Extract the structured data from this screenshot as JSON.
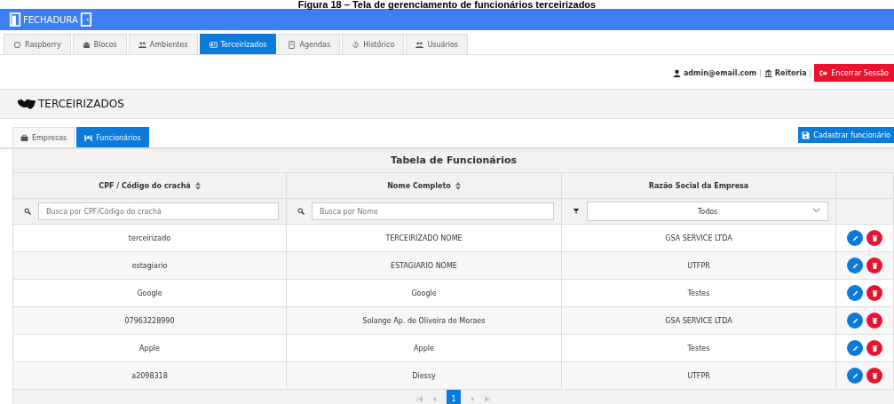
{
  "caption": "Figura 18 – Tela de gerenciamento de funcionários terceirizados",
  "brand": "FECHADURA",
  "nav_tabs": [
    {
      "label": "Raspberry",
      "selected": false
    },
    {
      "label": "Blocos",
      "selected": false
    },
    {
      "label": "Ambientes",
      "selected": false
    },
    {
      "label": "Terceirizados",
      "selected": true
    },
    {
      "label": "Agendas",
      "selected": false
    },
    {
      "label": "Histórico",
      "selected": false
    },
    {
      "label": "Usuários",
      "selected": false
    }
  ],
  "user_bar": {
    "email": "admin@email.com",
    "separator_1": "|",
    "unit": "Reitoria",
    "separator_2": "|",
    "logout": "Encerrar Sessão"
  },
  "page_title": "TERCEIRIZADOS",
  "sub_tabs": [
    {
      "label": "Empresas",
      "selected": false
    },
    {
      "label": "Funcionários",
      "selected": true
    }
  ],
  "create_button": "Cadastrar funcionário",
  "table": {
    "title": "Tabela de Funcionários",
    "columns": [
      {
        "label": "CPF / Código do crachá",
        "sortable": true
      },
      {
        "label": "Nome Completo",
        "sortable": true
      },
      {
        "label": "Razão Social da Empresa",
        "sortable": false
      }
    ],
    "filters": [
      {
        "kind": "search",
        "placeholder": "Busca por CPF/Código do crachá"
      },
      {
        "kind": "search",
        "placeholder": "Busca por Nome"
      },
      {
        "kind": "select",
        "value": "Todos"
      }
    ],
    "rows": [
      [
        "terceirizado",
        "TERCEIRIZADO NOME",
        "GSA SERVICE LTDA"
      ],
      [
        "estagiario",
        "ESTAGIARIO NOME",
        "UTFPR"
      ],
      [
        "Google",
        "Google",
        "Testes"
      ],
      [
        "07963228990",
        "Solange Ap. de Oliveira de Moraes",
        "GSA SERVICE LTDA"
      ],
      [
        "Apple",
        "Apple",
        "Testes"
      ],
      [
        "a2098318",
        "Diessy",
        "UTFPR"
      ]
    ],
    "pages": [
      {
        "label": "1",
        "selected": true
      }
    ]
  }
}
